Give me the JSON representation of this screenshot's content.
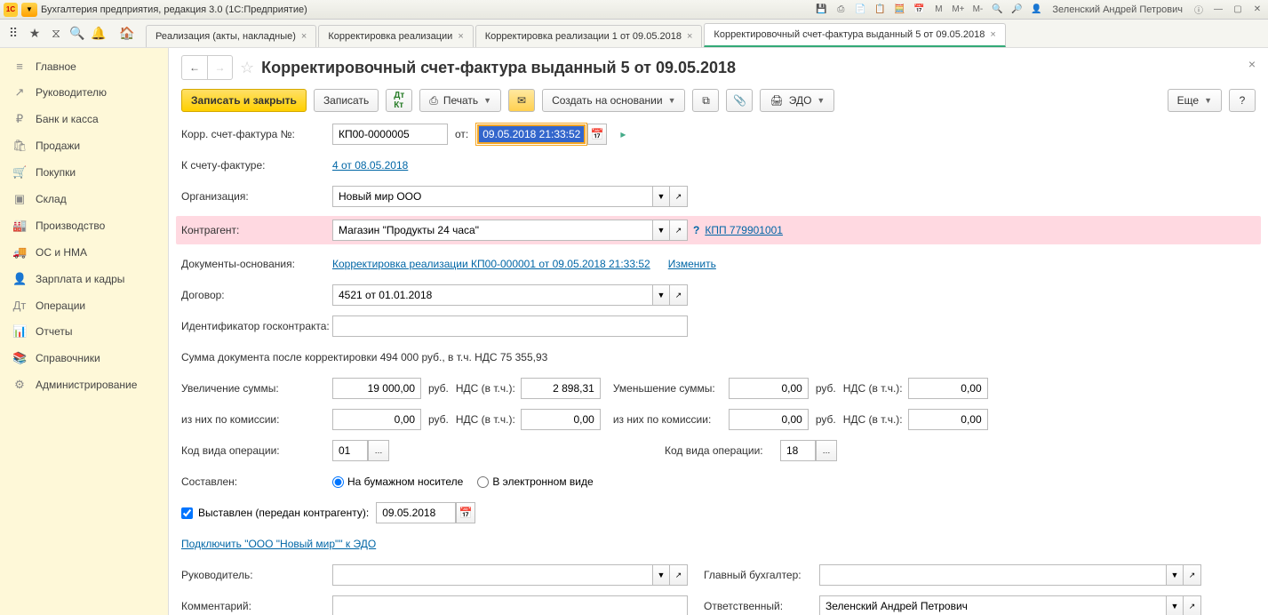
{
  "titlebar": {
    "app_title": "Бухгалтерия предприятия, редакция 3.0  (1С:Предприятие)",
    "user": "Зеленский Андрей Петрович",
    "m_labels": [
      "M",
      "M+",
      "M-"
    ]
  },
  "tabs": [
    {
      "label": "Реализация (акты, накладные)"
    },
    {
      "label": "Корректировка реализации"
    },
    {
      "label": "Корректировка реализации 1 от 09.05.2018"
    },
    {
      "label": "Корректировочный счет-фактура выданный 5 от 09.05.2018",
      "active": true
    }
  ],
  "sidebar": [
    {
      "icon": "≡",
      "label": "Главное"
    },
    {
      "icon": "↗",
      "label": "Руководителю"
    },
    {
      "icon": "₽",
      "label": "Банк и касса"
    },
    {
      "icon": "🛍",
      "label": "Продажи"
    },
    {
      "icon": "🛒",
      "label": "Покупки"
    },
    {
      "icon": "▣",
      "label": "Склад"
    },
    {
      "icon": "🏭",
      "label": "Производство"
    },
    {
      "icon": "🚚",
      "label": "ОС и НМА"
    },
    {
      "icon": "👤",
      "label": "Зарплата и кадры"
    },
    {
      "icon": "Дт",
      "label": "Операции"
    },
    {
      "icon": "📊",
      "label": "Отчеты"
    },
    {
      "icon": "📚",
      "label": "Справочники"
    },
    {
      "icon": "⚙",
      "label": "Администрирование"
    }
  ],
  "document": {
    "title": "Корректировочный счет-фактура выданный 5 от 09.05.2018"
  },
  "toolbar": {
    "save_close": "Записать и закрыть",
    "save": "Записать",
    "print": "Печать",
    "create_based": "Создать на основании",
    "edo": "ЭДО",
    "more": "Еще",
    "help": "?"
  },
  "form": {
    "corr_number_label": "Корр. счет-фактура №:",
    "corr_number": "КП00-0000005",
    "from_label": "от:",
    "corr_date": "09.05.2018 21:33:52",
    "to_invoice_label": "К счету-фактуре:",
    "to_invoice_link": "4 от 08.05.2018",
    "org_label": "Организация:",
    "org_value": "Новый мир ООО",
    "counterparty_label": "Контрагент:",
    "counterparty_value": "Магазин \"Продукты 24 часа\"",
    "kpp_link": "КПП 779901001",
    "basis_label": "Документы-основания:",
    "basis_link": "Корректировка реализации КП00-000001 от 09.05.2018 21:33:52",
    "change_link": "Изменить",
    "contract_label": "Договор:",
    "contract_value": "4521 от 01.01.2018",
    "gos_id_label": "Идентификатор госконтракта:",
    "gos_id_value": "",
    "sum_text": "Сумма документа после корректировки 494 000 руб., в т.ч. НДС 75 355,93",
    "inc_sum_label": "Увеличение суммы:",
    "inc_sum": "19 000,00",
    "rub": "руб.",
    "vat_incl_label": "НДС (в т.ч.):",
    "inc_vat": "2 898,31",
    "dec_sum_label": "Уменьшение суммы:",
    "dec_sum": "0,00",
    "dec_vat": "0,00",
    "comm_label": "из них по комиссии:",
    "inc_comm": "0,00",
    "inc_comm_vat": "0,00",
    "dec_comm": "0,00",
    "dec_comm_vat": "0,00",
    "op_code_label_l": "Код вида операции:",
    "op_code_l": "01",
    "op_code_label_r": "Код вида операции:",
    "op_code_r": "18",
    "composed_label": "Составлен:",
    "radio_paper": "На бумажном носителе",
    "radio_elec": "В электронном виде",
    "issued_checkbox": "Выставлен (передан контрагенту):",
    "issued_date": "09.05.2018",
    "edo_connect_link": "Подключить \"ООО \"Новый мир\"\" к ЭДО",
    "manager_label": "Руководитель:",
    "manager_value": "",
    "accountant_label": "Главный бухгалтер:",
    "accountant_value": "",
    "comment_label": "Комментарий:",
    "comment_value": "",
    "responsible_label": "Ответственный:",
    "responsible_value": "Зеленский Андрей Петрович"
  }
}
